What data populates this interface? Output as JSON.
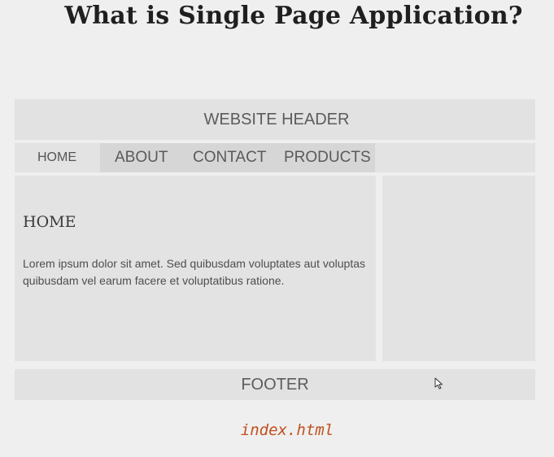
{
  "slide": {
    "title": "What is Single Page Application?",
    "file_label": "index.html"
  },
  "website": {
    "header_label": "WEBSITE HEADER",
    "nav": {
      "home": "HOME",
      "about": "ABOUT",
      "contact": "CONTACT",
      "products": "PRODUCTS"
    },
    "main": {
      "heading": "HOME",
      "body": "Lorem ipsum dolor sit amet. Sed quibusdam voluptates aut voluptas quibusdam vel earum facere et voluptatibus ratione."
    },
    "footer_label": "FOOTER"
  },
  "colors": {
    "background": "#efefef",
    "panel": "#e3e3e3",
    "nav_highlight": "#d6d6d6",
    "file_label": "#c0501e"
  },
  "icons": {
    "cursor": "mouse-pointer-icon"
  }
}
